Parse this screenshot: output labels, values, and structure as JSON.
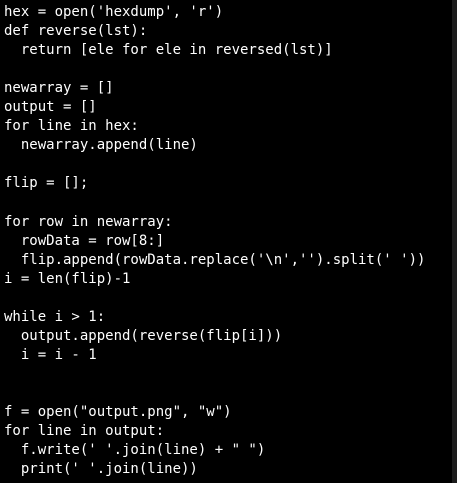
{
  "editor": {
    "lines": [
      "hex = open('hexdump', 'r')",
      "def reverse(lst):",
      "  return [ele for ele in reversed(lst)]",
      "",
      "newarray = []",
      "output = []",
      "for line in hex:",
      "  newarray.append(line)",
      "",
      "flip = [];",
      "",
      "for row in newarray:",
      "  rowData = row[8:]",
      "  flip.append(rowData.replace('\\n','').split(' '))",
      "i = len(flip)-1",
      "",
      "while i > 1:",
      "  output.append(reverse(flip[i]))",
      "  i = i - 1",
      "",
      "",
      "f = open(\"output.png\", \"w\")",
      "for line in output:",
      "  f.write(' '.join(line) + \" \")",
      "  print(' '.join(line))"
    ]
  }
}
